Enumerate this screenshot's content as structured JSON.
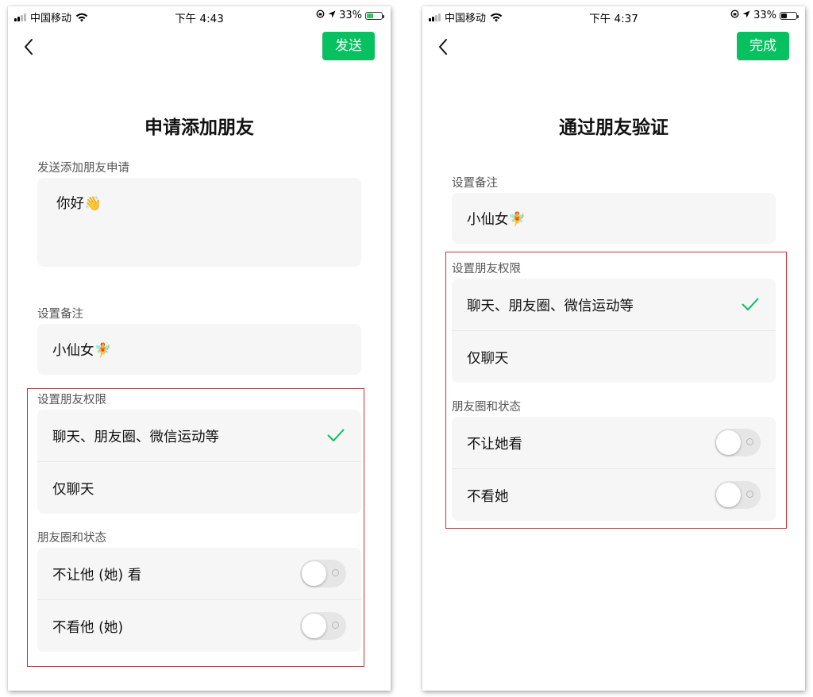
{
  "left_screen": {
    "status": {
      "carrier": "中国移动",
      "time": "下午 4:43",
      "battery": "33%",
      "battery_color": "#34c759"
    },
    "action_button": "发送",
    "title": "申请添加朋友",
    "request_label": "发送添加朋友申请",
    "request_value": "你好👋",
    "remark_label": "设置备注",
    "remark_value": "小仙女🧚",
    "permission_label": "设置朋友权限",
    "permission_options": [
      "聊天、朋友圈、微信运动等",
      "仅聊天"
    ],
    "moments_label": "朋友圈和状态",
    "moments_options": [
      "不让他 (她) 看",
      "不看他 (她)"
    ]
  },
  "right_screen": {
    "status": {
      "carrier": "中国移动",
      "time": "下午 4:37",
      "battery": "33%",
      "battery_color": "#111111"
    },
    "action_button": "完成",
    "title": "通过朋友验证",
    "remark_label": "设置备注",
    "remark_value": "小仙女🧚",
    "permission_label": "设置朋友权限",
    "permission_options": [
      "聊天、朋友圈、微信运动等",
      "仅聊天"
    ],
    "moments_label": "朋友圈和状态",
    "moments_options": [
      "不让她看",
      "不看她"
    ]
  },
  "colors": {
    "accent": "#07c160",
    "highlight_box": "#d32f2f"
  }
}
